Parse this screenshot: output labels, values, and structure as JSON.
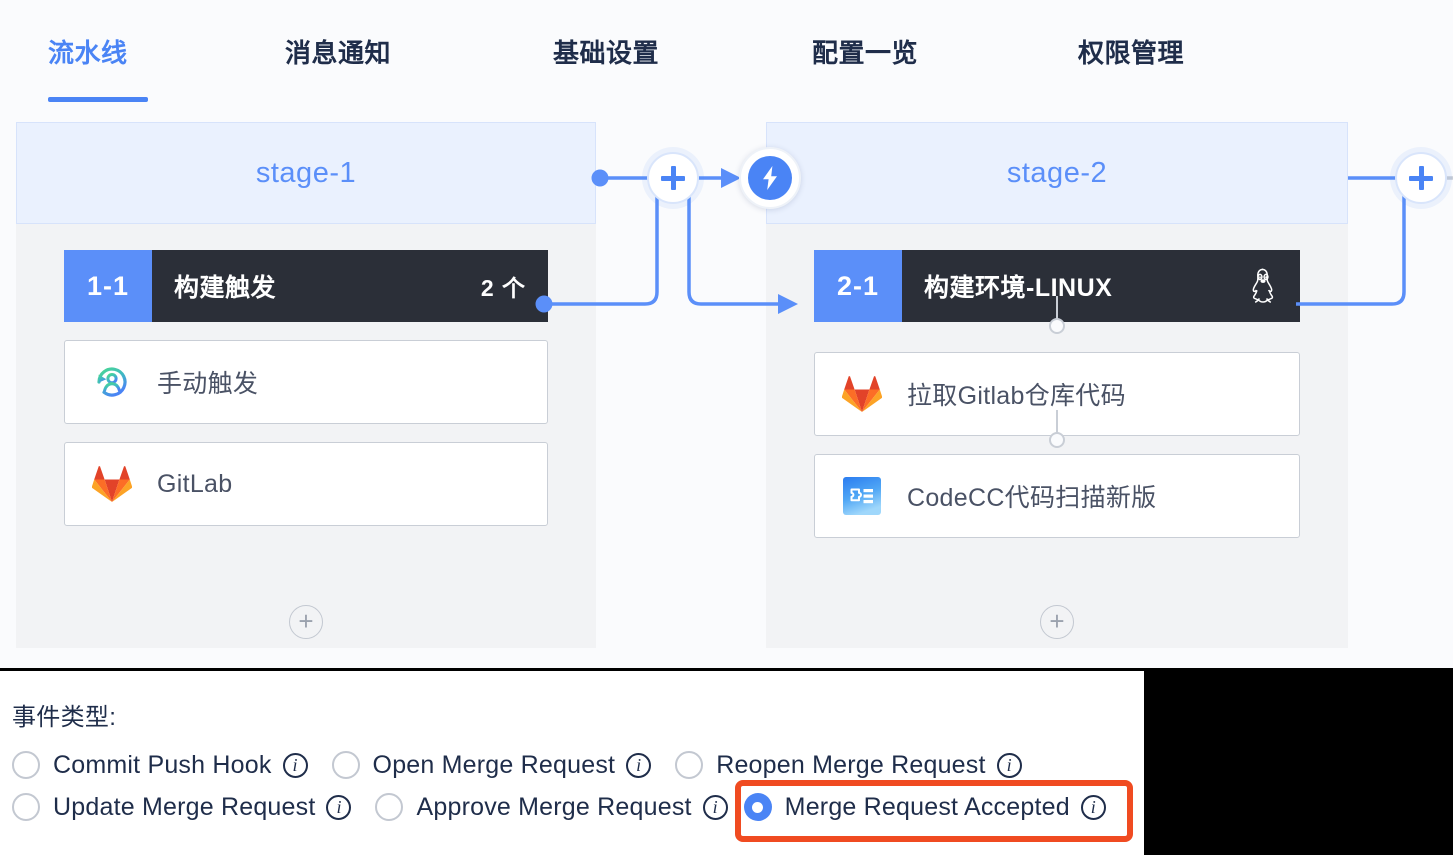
{
  "tabs": [
    {
      "label": "流水线",
      "active": true
    },
    {
      "label": "消息通知",
      "active": false
    },
    {
      "label": "基础设置",
      "active": false
    },
    {
      "label": "配置一览",
      "active": false
    },
    {
      "label": "权限管理",
      "active": false
    }
  ],
  "pipeline": {
    "stages": [
      {
        "title": "stage-1",
        "job": {
          "index": "1-1",
          "name": "构建触发",
          "count": "2 个",
          "os_icon": ""
        },
        "plugins": [
          {
            "icon": "manual-trigger-icon",
            "label": "手动触发"
          },
          {
            "icon": "gitlab-icon",
            "label": "GitLab"
          }
        ],
        "add_plugin_label": "+"
      },
      {
        "title": "stage-2",
        "job": {
          "index": "2-1",
          "name": "构建环境-LINUX",
          "count": "",
          "os_icon": "linux-penguin-icon"
        },
        "plugins": [
          {
            "icon": "gitlab-icon",
            "label": "拉取Gitlab仓库代码"
          },
          {
            "icon": "codecc-icon",
            "label": "CodeCC代码扫描新版"
          }
        ],
        "add_plugin_label": "+"
      }
    ],
    "controls": {
      "add_stage_label": "+",
      "trigger_bolt_name": "lightning-bolt-icon"
    }
  },
  "form": {
    "title": "事件类型:",
    "rows": [
      [
        {
          "label": "Commit Push Hook",
          "checked": false,
          "info": "i"
        },
        {
          "label": "Open Merge Request",
          "checked": false,
          "info": "i"
        },
        {
          "label": "Reopen Merge Request",
          "checked": false,
          "info": "i"
        }
      ],
      [
        {
          "label": "Update Merge Request",
          "checked": false,
          "info": "i"
        },
        {
          "label": "Approve Merge Request",
          "checked": false,
          "info": "i"
        },
        {
          "label": "Merge Request Accepted",
          "checked": true,
          "info": "i"
        }
      ]
    ],
    "highlighted_option": "Merge Request Accepted"
  },
  "colors": {
    "accent_blue": "#4a84f5",
    "stage_header_bg": "#eaf1fe",
    "job_bar_bg": "#2b2f38",
    "job_index_bg": "#5b8ff9",
    "highlight_orange": "#f04b21",
    "text_navy": "#1f2d4a"
  }
}
